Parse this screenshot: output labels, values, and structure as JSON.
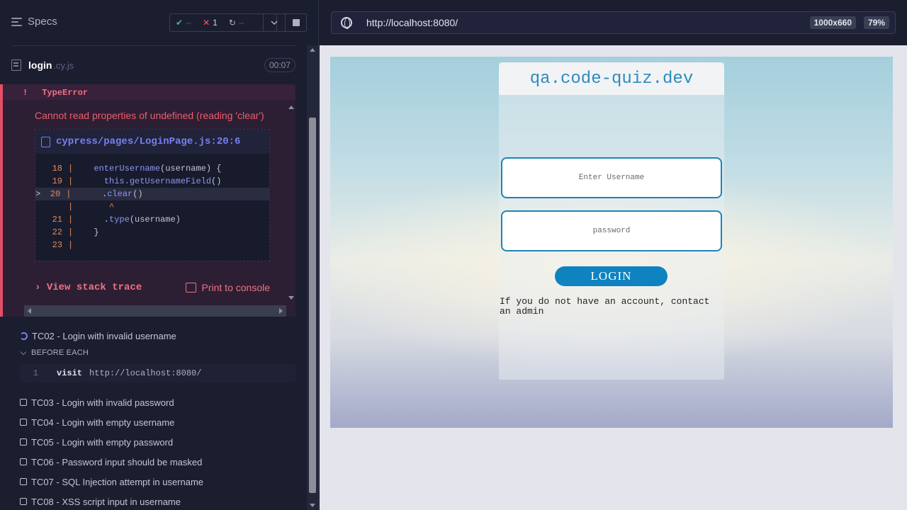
{
  "header": {
    "specs_label": "Specs",
    "stats": {
      "passed": "--",
      "failed": "1",
      "pending": "--"
    }
  },
  "spec": {
    "name": "login",
    "ext": ".cy.js",
    "duration": "00:07"
  },
  "error": {
    "marker": "!",
    "type": "TypeError",
    "message": "Cannot read properties of undefined (reading 'clear')",
    "file": "cypress/pages/LoginPage.js:20:6",
    "lines": [
      {
        "num": "18",
        "pre": "  ",
        "fn": "enterUsername",
        "post": "(username) {"
      },
      {
        "num": "19",
        "pre": "    ",
        "kw": "this.",
        "fn": "getUsernameField",
        "post": "()"
      },
      {
        "num": "20",
        "marker": ">",
        "pre": "    .",
        "fn": "clear",
        "post": "()"
      },
      {
        "num": "",
        "pre": "     ",
        "caret": "^"
      },
      {
        "num": "21",
        "pre": "    .",
        "fn": "type",
        "post": "(username)"
      },
      {
        "num": "22",
        "pre": "  }"
      },
      {
        "num": "23",
        "pre": ""
      }
    ],
    "stack_label": "View stack trace",
    "print_label": "Print to console"
  },
  "tests": {
    "running": "TC02 - Login with invalid username",
    "before_each_label": "BEFORE EACH",
    "command": {
      "num": "1",
      "name": "visit",
      "url": "http://localhost:8080/"
    },
    "queued": [
      "TC03 - Login with invalid password",
      "TC04 - Login with empty username",
      "TC05 - Login with empty password",
      "TC06 - Password input should be masked",
      "TC07 - SQL Injection attempt in username",
      "TC08 - XSS script input in username"
    ]
  },
  "aut": {
    "url": "http://localhost:8080/",
    "viewport": "1000x660",
    "zoom": "79%"
  },
  "app": {
    "title": "qa.code-quiz.dev",
    "username_placeholder": "Enter Username",
    "password_placeholder": "password",
    "login_label": "LOGIN",
    "note": "If you do not have an account, contact an admin"
  },
  "colors": {
    "fail": "#f05a6e",
    "pass": "#3fb98e",
    "accent": "#7a7ff0",
    "login_button": "#0e83c0"
  }
}
